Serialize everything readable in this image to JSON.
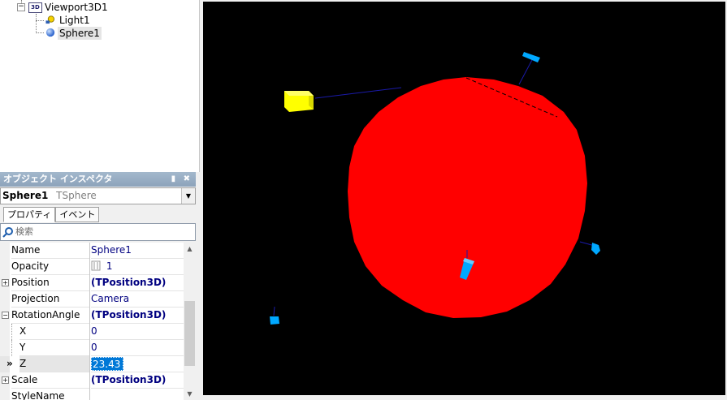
{
  "tree": {
    "viewport_label": "Viewport3D1",
    "viewport_icon_text": "3D",
    "children": [
      "Light1",
      "Sphere1"
    ],
    "expander_symbol": "−"
  },
  "inspector": {
    "title": "オブジェクト インスペクタ",
    "title_buttons": "▮ ✖",
    "object_name": "Sphere1",
    "object_type": "TSphere",
    "tabs": [
      "プロパティ",
      "イベント"
    ],
    "search_placeholder": "検索",
    "properties": [
      {
        "name": "Name",
        "value": "Sphere1",
        "bold": false,
        "expandable": false,
        "sub": false
      },
      {
        "name": "Opacity",
        "value": "1",
        "bold": false,
        "expandable": false,
        "sub": false,
        "value_icon": "slider-icon"
      },
      {
        "name": "Position",
        "value": "(TPosition3D)",
        "bold": true,
        "expandable": true,
        "expanded": false,
        "sub": false
      },
      {
        "name": "Projection",
        "value": "Camera",
        "bold": false,
        "expandable": false,
        "sub": false
      },
      {
        "name": "RotationAngle",
        "value": "(TPosition3D)",
        "bold": true,
        "expandable": true,
        "expanded": true,
        "sub": false
      },
      {
        "name": "X",
        "value": "0",
        "bold": false,
        "expandable": false,
        "sub": true
      },
      {
        "name": "Y",
        "value": "0",
        "bold": false,
        "expandable": false,
        "sub": true
      },
      {
        "name": "Z",
        "value": "23.43",
        "bold": false,
        "expandable": false,
        "sub": true,
        "selected": true,
        "editing": true,
        "marker": "»"
      },
      {
        "name": "Scale",
        "value": "(TPosition3D)",
        "bold": true,
        "expandable": true,
        "expanded": false,
        "sub": false
      },
      {
        "name": "StyleName",
        "value": "",
        "bold": false,
        "expandable": false,
        "sub": false
      }
    ]
  },
  "viewport": {
    "background": "#000000",
    "sphere_color": "#ff0000",
    "light_color": "#ffff00",
    "handle_color": "#00aaff",
    "line_color": "#0000aa"
  },
  "colors": {
    "title_bar": "#9aafc6",
    "value_text": "#000080",
    "selection": "#0078d7"
  }
}
